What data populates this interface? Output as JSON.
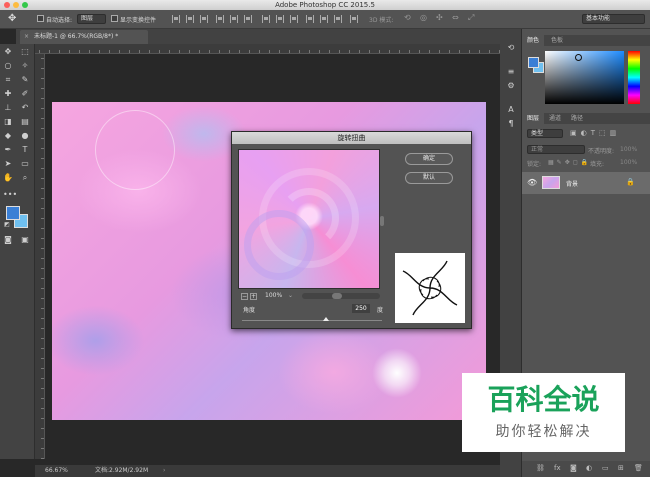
{
  "window": {
    "title": "Adobe Photoshop CC 2015.5"
  },
  "options_bar": {
    "auto_select_label": "自动选择:",
    "auto_select_value": "图层",
    "show_transform_label": "显示变换控件",
    "mode_3d_label": "3D 模式:",
    "workspace": "基本功能"
  },
  "document": {
    "tab_label": "未标题-1 @ 66.7%(RGB/8*) *"
  },
  "status": {
    "zoom": "66.67%",
    "doc_size": "文档:2.92M/2.92M"
  },
  "dialog": {
    "title": "旋转扭曲",
    "ok_label": "确定",
    "default_label": "默认",
    "zoom": "100%",
    "angle_label": "角度",
    "angle_value": "250",
    "angle_unit": "度",
    "angle_slider": 0.6
  },
  "panels": {
    "color_tabs": [
      "颜色",
      "色板"
    ],
    "layer_tabs": [
      "图层",
      "通道",
      "路径"
    ],
    "kind_filter": "类型",
    "blend_mode": "正常",
    "opacity_label": "不透明度:",
    "opacity_value": "100%",
    "lock_label": "锁定:",
    "fill_label": "填充:",
    "fill_value": "100%",
    "layer_name": "背景"
  },
  "watermark": {
    "line1": "百科全说",
    "line2": "助你轻松解决"
  },
  "colors": {
    "foreground": "#3a7fd5",
    "background": "#6fc0f0",
    "accent_green": "#1aa25a"
  }
}
